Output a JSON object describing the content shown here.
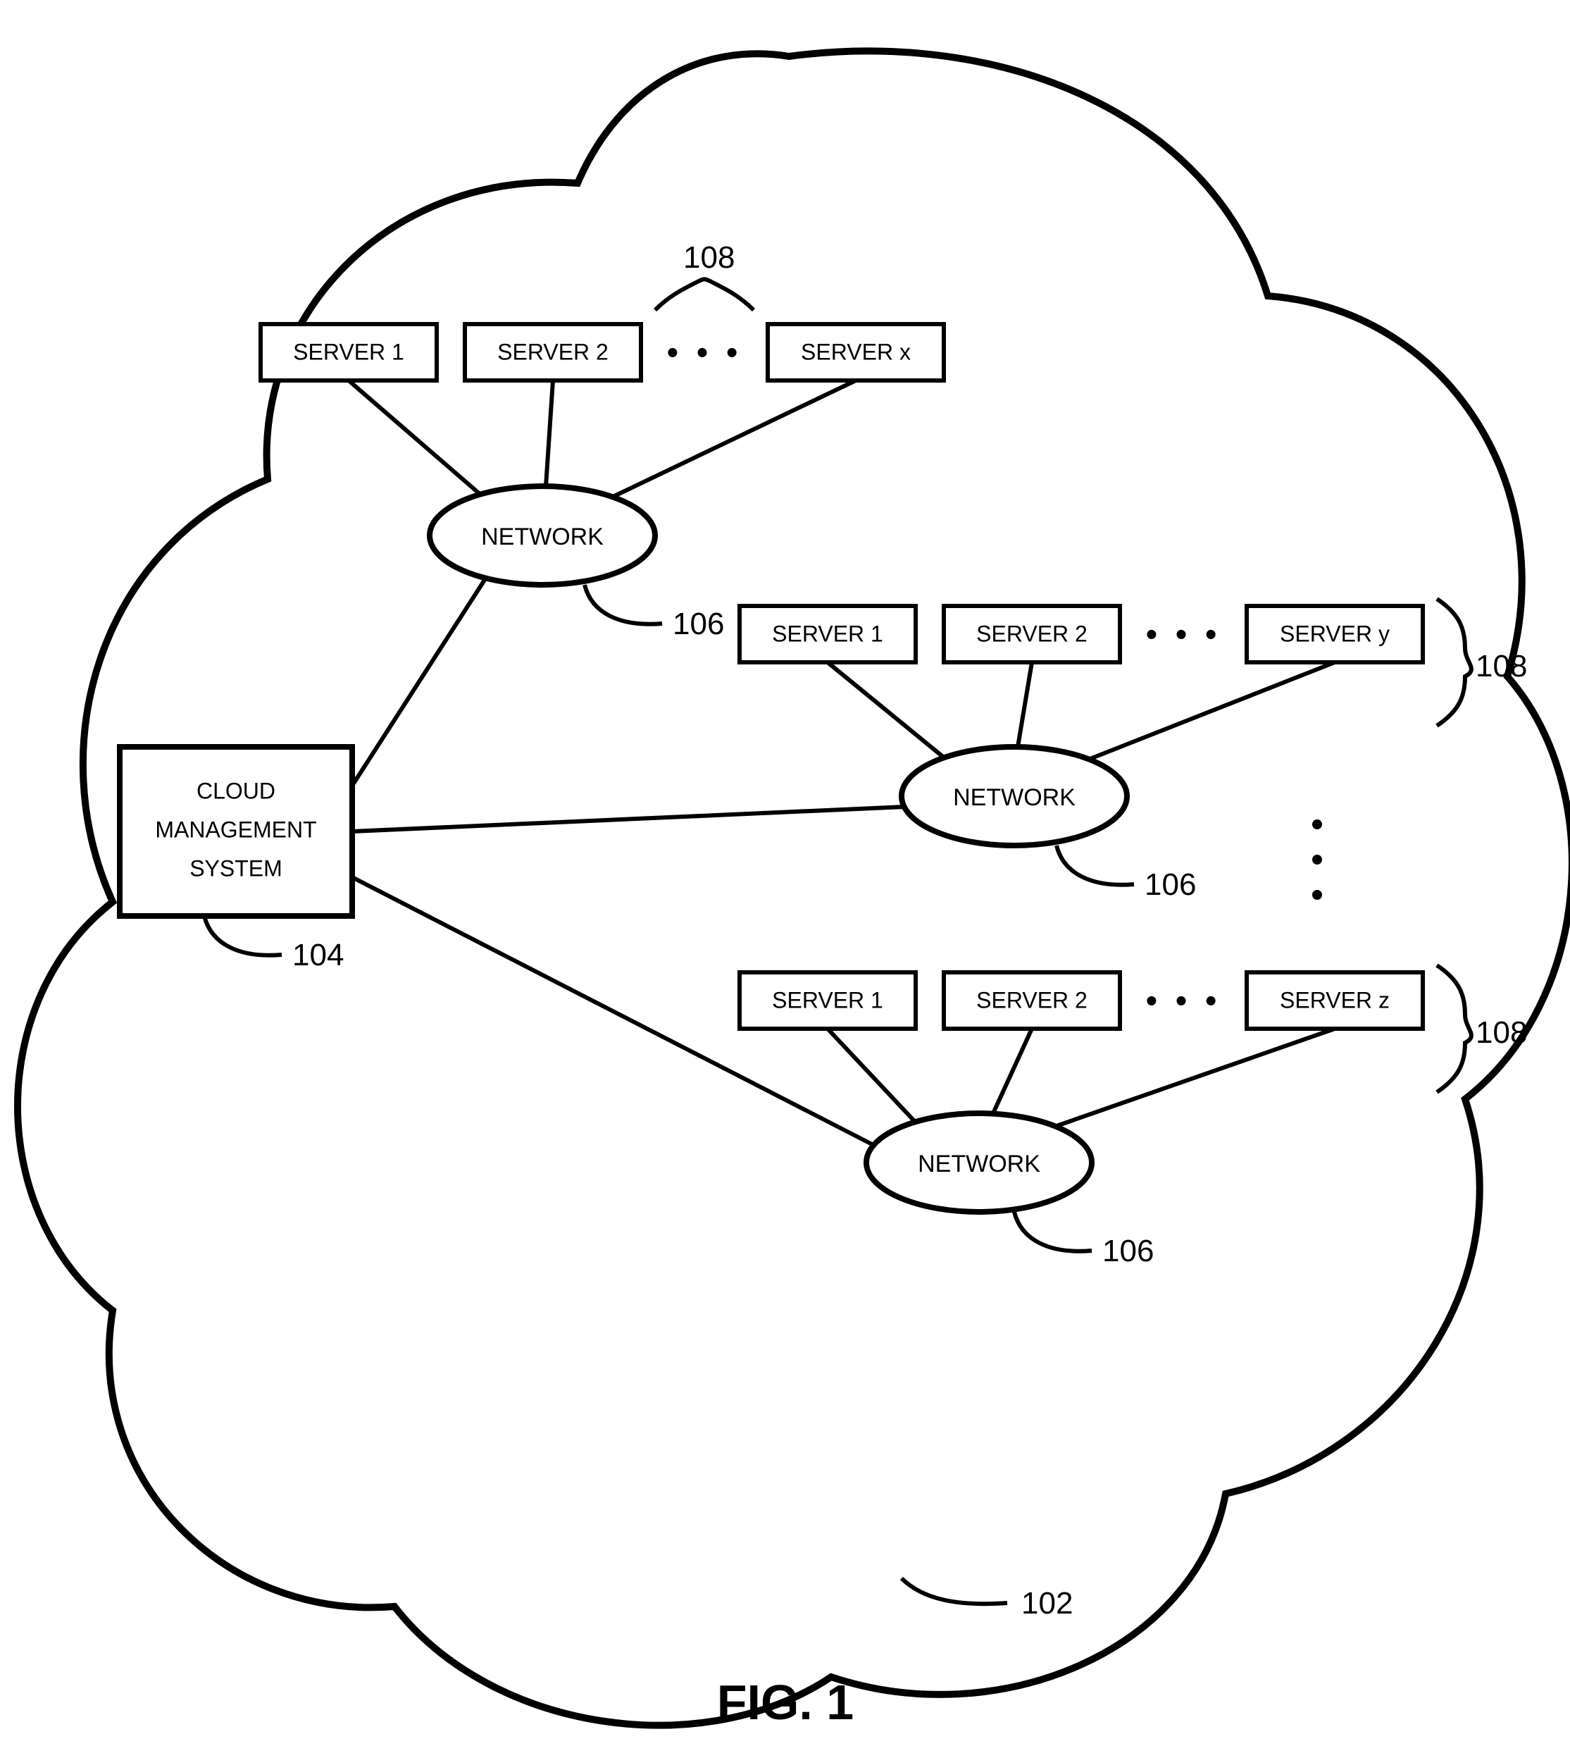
{
  "figure_label": "FIG. 1",
  "cloud_ref": "102",
  "cms": {
    "line1": "CLOUD",
    "line2": "MANAGEMENT",
    "line3": "SYSTEM",
    "ref": "104"
  },
  "network_label": "NETWORK",
  "network_ref": "106",
  "ellipsis": "• • •",
  "clusters": [
    {
      "servers": [
        "SERVER 1",
        "SERVER 2",
        "SERVER x"
      ],
      "ref": "108"
    },
    {
      "servers": [
        "SERVER 1",
        "SERVER 2",
        "SERVER y"
      ],
      "ref": "108"
    },
    {
      "servers": [
        "SERVER 1",
        "SERVER 2",
        "SERVER z"
      ],
      "ref": "108"
    }
  ]
}
